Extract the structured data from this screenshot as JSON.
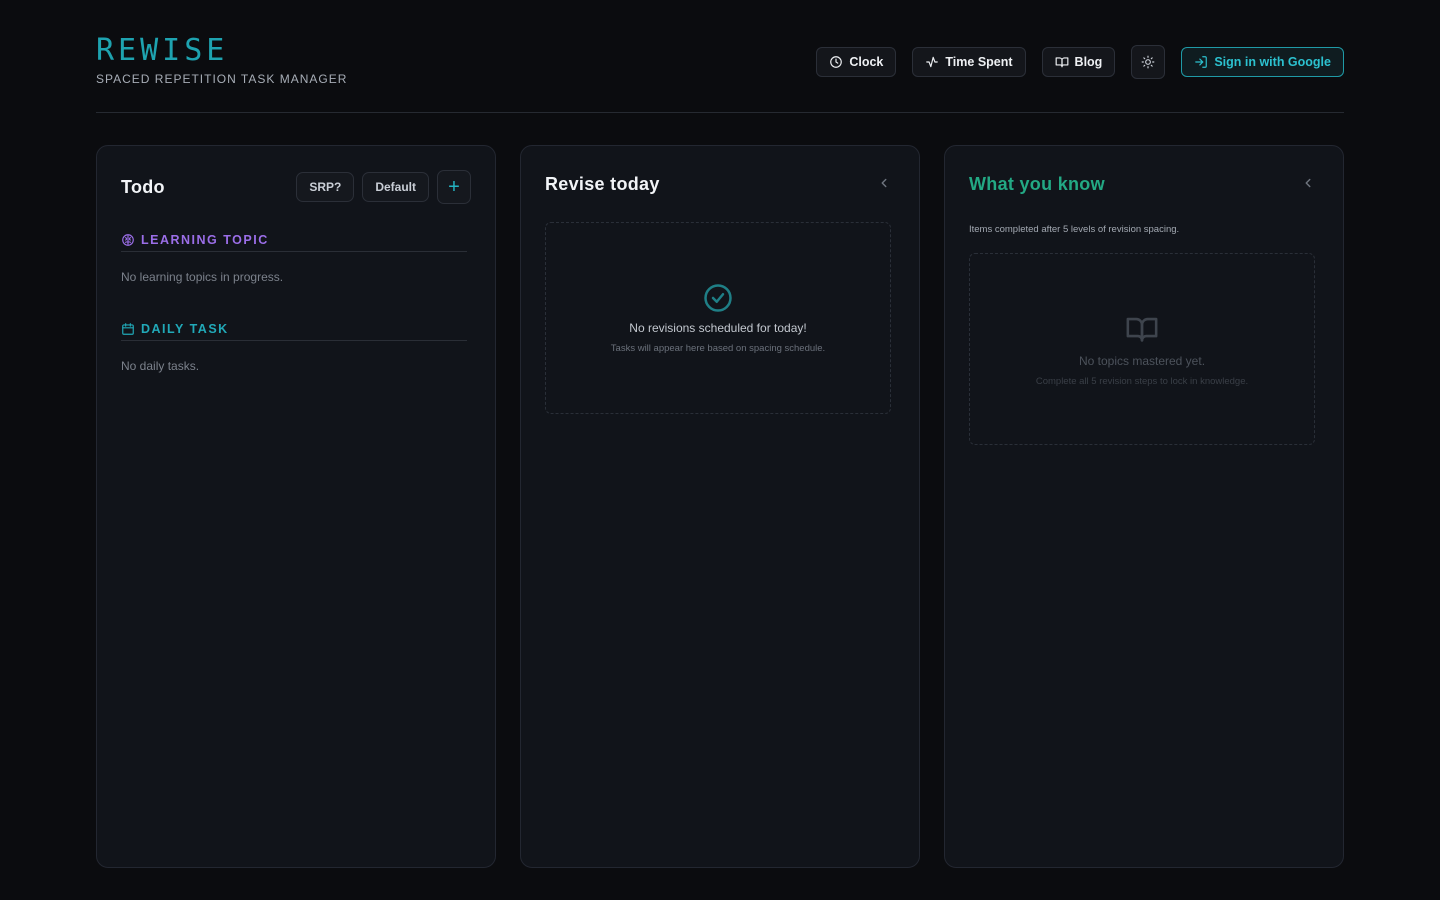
{
  "app": {
    "logo": "REWISE",
    "subtitle": "SPACED REPETITION TASK MANAGER"
  },
  "nav": {
    "clock": "Clock",
    "time_spent": "Time Spent",
    "blog": "Blog",
    "sign_in": "Sign in with Google"
  },
  "todo": {
    "title": "Todo",
    "srp_label": "SRP?",
    "default_label": "Default",
    "add_label": "+",
    "learning_topic": {
      "heading": "LEARNING TOPIC",
      "empty": "No learning topics in progress."
    },
    "daily_task": {
      "heading": "DAILY TASK",
      "empty": "No daily tasks."
    }
  },
  "revise": {
    "title": "Revise today",
    "empty_main": "No revisions scheduled for today!",
    "empty_sub": "Tasks will appear here based on spacing schedule."
  },
  "know": {
    "title": "What you know",
    "description": "Items completed after 5 levels of revision spacing.",
    "empty_main": "No topics mastered yet.",
    "empty_sub": "Complete all 5 revision steps to lock in knowledge."
  },
  "colors": {
    "accent": "#1ea3b0",
    "learning": "#9b6ee8",
    "daily": "#21a9b8",
    "know": "#23a884",
    "background": "#0b0c0f",
    "panel": "#11141a"
  }
}
